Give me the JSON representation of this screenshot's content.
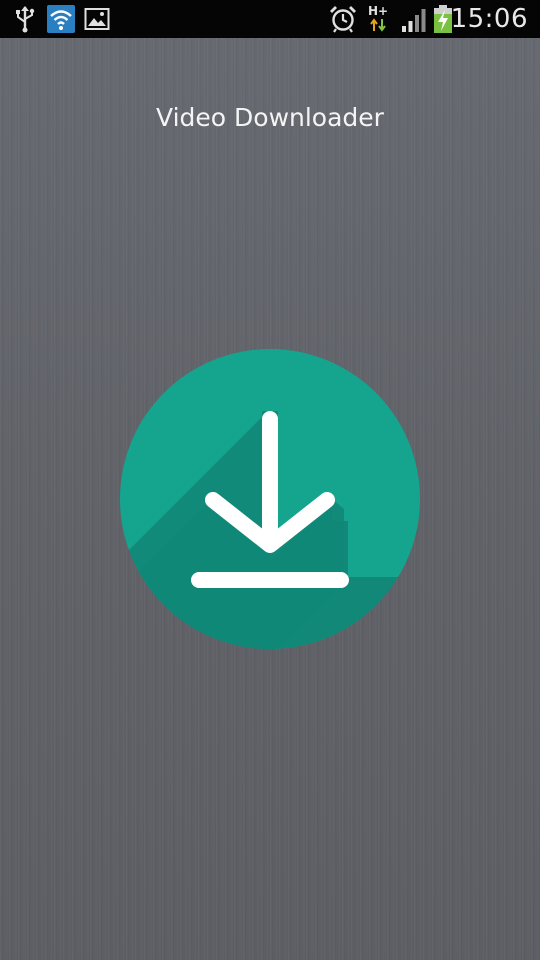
{
  "status_bar": {
    "time": "15:06",
    "network_type": "H+",
    "icons": [
      "usb-icon",
      "wifi-icon",
      "gallery-icon",
      "alarm-icon",
      "mobile-data-icon",
      "signal-icon",
      "battery-charging-icon"
    ]
  },
  "app": {
    "title": "Video Downloader",
    "logo_icon": "download-icon",
    "colors": {
      "background": "#606268",
      "logo_circle": "#15a58f",
      "logo_shadow": "#118878",
      "arrow": "#ffffff"
    }
  }
}
